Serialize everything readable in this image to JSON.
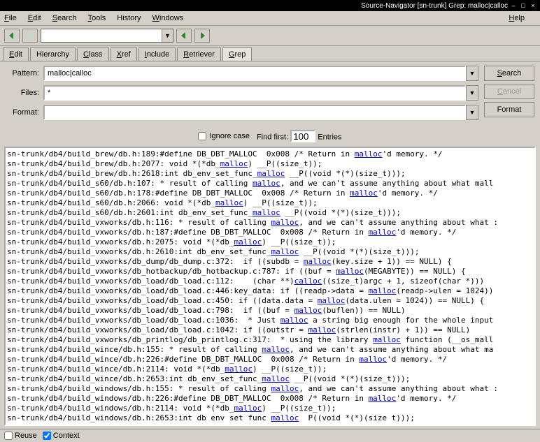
{
  "titlebar": {
    "text": "Source-Navigator [sn-trunk] Grep: malloc|calloc"
  },
  "menubar": {
    "file": "File",
    "edit": "Edit",
    "search": "Search",
    "tools": "Tools",
    "history": "History",
    "windows": "Windows",
    "help": "Help"
  },
  "tabs": {
    "edit": "Edit",
    "hierarchy": "Hierarchy",
    "class": "Class",
    "xref": "Xref",
    "include": "Include",
    "retriever": "Retriever",
    "grep": "Grep"
  },
  "form": {
    "pattern_label": "Pattern:",
    "pattern_value": "malloc|calloc",
    "files_label": "Files:",
    "files_value": "*",
    "format_label": "Format:",
    "format_value": "",
    "search_btn": "Search",
    "cancel_btn": "Cancel",
    "format_btn": "Format",
    "ignore_case": "Ignore case",
    "find_first": "Find first:",
    "find_first_val": "100",
    "entries": "Entries"
  },
  "status": {
    "reuse": "Reuse",
    "context": "Context"
  },
  "hl": "malloc",
  "results": [
    "sn-trunk/db4/build_brew/db.h:189:#define DB_DBT_MALLOC  0x008 /* Return in |malloc|'d memory. */",
    "sn-trunk/db4/build_brew/db.h:2077: void *(*db_|malloc|) __P((size_t));",
    "sn-trunk/db4/build_brew/db.h:2618:int db_env_set_func_|malloc| __P((void *(*)(size_t)));",
    "sn-trunk/db4/build_s60/db.h:107: * result of calling |malloc|, and we can't assume anything about what mall",
    "sn-trunk/db4/build_s60/db.h:178:#define DB_DBT_MALLOC  0x008 /* Return in |malloc|'d memory. */",
    "sn-trunk/db4/build_s60/db.h:2066: void *(*db_|malloc|) __P((size_t));",
    "sn-trunk/db4/build_s60/db.h:2601:int db_env_set_func_|malloc| __P((void *(*)(size_t)));",
    "sn-trunk/db4/build_vxworks/db.h:116: * result of calling |malloc|, and we can't assume anything about what :",
    "sn-trunk/db4/build_vxworks/db.h:187:#define DB_DBT_MALLOC  0x008 /* Return in |malloc|'d memory. */",
    "sn-trunk/db4/build_vxworks/db.h:2075: void *(*db_|malloc|) __P((size_t));",
    "sn-trunk/db4/build_vxworks/db.h:2610:int db_env_set_func_|malloc| __P((void *(*)(size_t)));",
    "sn-trunk/db4/build_vxworks/db_dump/db_dump.c:372:  if ((subdb = |malloc|(key.size + 1)) == NULL) {",
    "sn-trunk/db4/build_vxworks/db_hotbackup/db_hotbackup.c:787: if ((buf = |malloc|(MEGABYTE)) == NULL) {",
    "sn-trunk/db4/build_vxworks/db_load/db_load.c:112:    (char **)|calloc|((size_t)argc + 1, sizeof(char *)))",
    "sn-trunk/db4/build_vxworks/db_load/db_load.c:446:key_data: if ((readp->data = |malloc|(readp->ulen = 1024))",
    "sn-trunk/db4/build_vxworks/db_load/db_load.c:450: if ((data.data = |malloc|(data.ulen = 1024)) == NULL) {",
    "sn-trunk/db4/build_vxworks/db_load/db_load.c:798:  if ((buf = |malloc|(buflen)) == NULL)",
    "sn-trunk/db4/build_vxworks/db_load/db_load.c:1036:  * Just |malloc| a string big enough for the whole input",
    "sn-trunk/db4/build_vxworks/db_load/db_load.c:1042: if ((outstr = |malloc|(strlen(instr) + 1)) == NULL)",
    "sn-trunk/db4/build_vxworks/db_printlog/db_printlog.c:317:  * using the library |malloc| function (__os_mall",
    "sn-trunk/db4/build_wince/db.h:155: * result of calling |malloc|, and we can't assume anything about what ma",
    "sn-trunk/db4/build_wince/db.h:226:#define DB_DBT_MALLOC  0x008 /* Return in |malloc|'d memory. */",
    "sn-trunk/db4/build_wince/db.h:2114: void *(*db_|malloc|) __P((size_t));",
    "sn-trunk/db4/build_wince/db.h:2653:int db_env_set_func_|malloc| __P((void *(*)(size_t)));",
    "sn-trunk/db4/build_windows/db.h:155: * result of calling |malloc|, and we can't assume anything about what :",
    "sn-trunk/db4/build_windows/db.h:226:#define DB_DBT_MALLOC  0x008 /* Return in |malloc|'d memory. */",
    "sn-trunk/db4/build_windows/db.h:2114: void *(*db_|malloc|) __P((size_t));",
    "sn-trunk/db4/build_windows/db.h:2653:int db env set func |malloc|  P((void *(*)(size t)));"
  ]
}
